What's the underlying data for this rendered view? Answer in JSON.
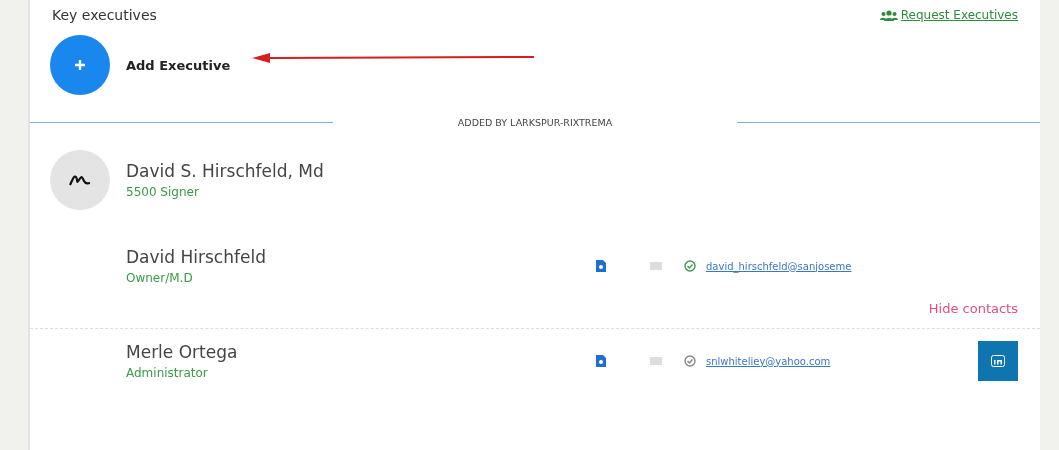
{
  "section": {
    "title": "Key executives",
    "request_link": "Request Executives"
  },
  "add_button": {
    "label": "Add Executive"
  },
  "divider": {
    "label": "ADDED BY LARKSPUR-RIXTREMA"
  },
  "executive": {
    "name": "David S. Hirschfeld, Md",
    "role": "5500 Signer"
  },
  "contacts": [
    {
      "name": "David Hirschfeld",
      "role": "Owner/M.D",
      "email": "david_hirschfeld@sanjoseme",
      "verified": true,
      "linkedin": false
    },
    {
      "name": "Merle Ortega",
      "role": "Administrator",
      "email": "snlwhiteliey@yahoo.com",
      "verified": false,
      "linkedin": true
    }
  ],
  "hide_link": "Hide contacts"
}
